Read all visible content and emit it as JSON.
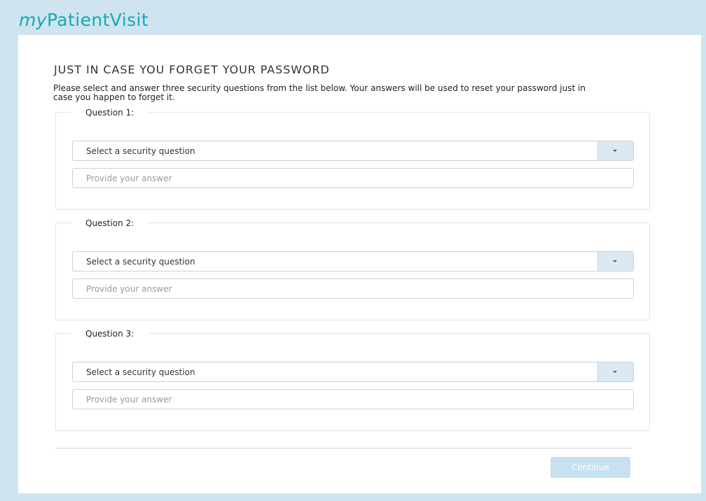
{
  "brand": {
    "prefix": "my",
    "name": "PatientVisit"
  },
  "page": {
    "title": "JUST IN CASE YOU FORGET YOUR PASSWORD",
    "intro": "Please select and answer three security questions from the list below. Your answers will be used to reset your password just in case you happen to forget it."
  },
  "questions": [
    {
      "legend": "Question 1:",
      "select_text": "Select a security question",
      "answer_placeholder": "Provide your answer",
      "answer_value": ""
    },
    {
      "legend": "Question 2:",
      "select_text": "Select a security question",
      "answer_placeholder": "Provide your answer",
      "answer_value": ""
    },
    {
      "legend": "Question 3:",
      "select_text": "Select a security question",
      "answer_placeholder": "Provide your answer",
      "answer_value": ""
    }
  ],
  "actions": {
    "continue_label": "Continue",
    "continue_enabled": false
  },
  "colors": {
    "brand": "#12a9b8",
    "background": "#cfe4ee",
    "button_disabled": "#c6e1ef",
    "select_button": "#dce9f2"
  },
  "icons": {
    "dropdown": "chevron-down-icon"
  }
}
